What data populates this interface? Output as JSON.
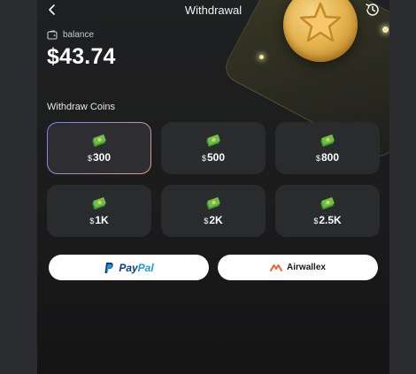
{
  "header": {
    "title": "Withdrawal",
    "back_icon": "back-arrow-icon",
    "history_icon": "history-clock-icon"
  },
  "balance": {
    "label": "balance",
    "value": "$43.74",
    "icon": "wallet-icon"
  },
  "withdraw": {
    "section_title": "Withdraw Coins",
    "currency_symbol": "$",
    "options": [
      {
        "amount": "300",
        "selected": true
      },
      {
        "amount": "500",
        "selected": false
      },
      {
        "amount": "800",
        "selected": false
      },
      {
        "amount": "1K",
        "selected": false
      },
      {
        "amount": "2K",
        "selected": false
      },
      {
        "amount": "2.5K",
        "selected": false
      }
    ]
  },
  "payment_methods": {
    "paypal": {
      "label_part1": "Pay",
      "label_part2": "Pal",
      "icon": "paypal-logo-icon"
    },
    "airwallex": {
      "label": "Airwallex",
      "icon": "airwallex-logo-icon"
    }
  },
  "colors": {
    "background": "#1f2021",
    "tile": "#2a2b2d",
    "accent_border": "#7a7dff",
    "coin": "#e6b550",
    "text": "#ffffff"
  }
}
